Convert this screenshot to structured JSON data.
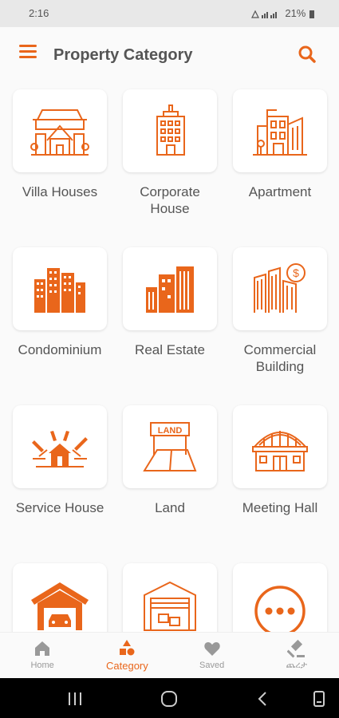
{
  "status": {
    "time": "2:16",
    "right": "21%"
  },
  "app_bar": {
    "title": "Property Category"
  },
  "categories": [
    {
      "label": "Villa Houses",
      "icon": "villa-icon"
    },
    {
      "label": "Corporate House",
      "icon": "corporate-building-icon"
    },
    {
      "label": "Apartment",
      "icon": "apartment-icon"
    },
    {
      "label": "Condominium",
      "icon": "condominium-icon"
    },
    {
      "label": "Real Estate",
      "icon": "real-estate-icon"
    },
    {
      "label": "Commercial Building",
      "icon": "commercial-building-icon"
    },
    {
      "label": "Service House",
      "icon": "service-house-icon"
    },
    {
      "label": "Land",
      "icon": "land-icon",
      "sign_text": "LAND"
    },
    {
      "label": "Meeting Hall",
      "icon": "meeting-hall-icon"
    },
    {
      "label": "",
      "icon": "garage-icon"
    },
    {
      "label": "",
      "icon": "warehouse-icon"
    },
    {
      "label": "",
      "icon": "more-icon"
    }
  ],
  "bottom_nav": [
    {
      "label": "Home",
      "icon": "home-icon",
      "active": false
    },
    {
      "label": "Category",
      "icon": "category-shapes-icon",
      "active": true
    },
    {
      "label": "Saved",
      "icon": "heart-icon",
      "active": false
    },
    {
      "label": "ጨረታ",
      "icon": "gavel-icon",
      "active": false
    }
  ],
  "colors": {
    "accent": "#e9661b",
    "text": "#555555",
    "inactive": "#999999"
  }
}
